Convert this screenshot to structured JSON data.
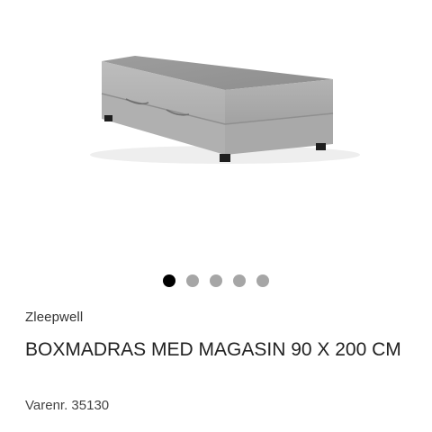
{
  "product": {
    "brand": "Zleepwell",
    "title": "BOXMADRAS MED MAGASIN 90 X 200 CM",
    "sku": "Varenr. 35130",
    "image_icon": "boxmattress-image"
  },
  "gallery": {
    "slide_count": 5,
    "active_index": 0
  },
  "colors": {
    "dot_active": "#000000",
    "dot_inactive": "#a6a6a6",
    "mattress_gray": "#9b9b9b"
  }
}
